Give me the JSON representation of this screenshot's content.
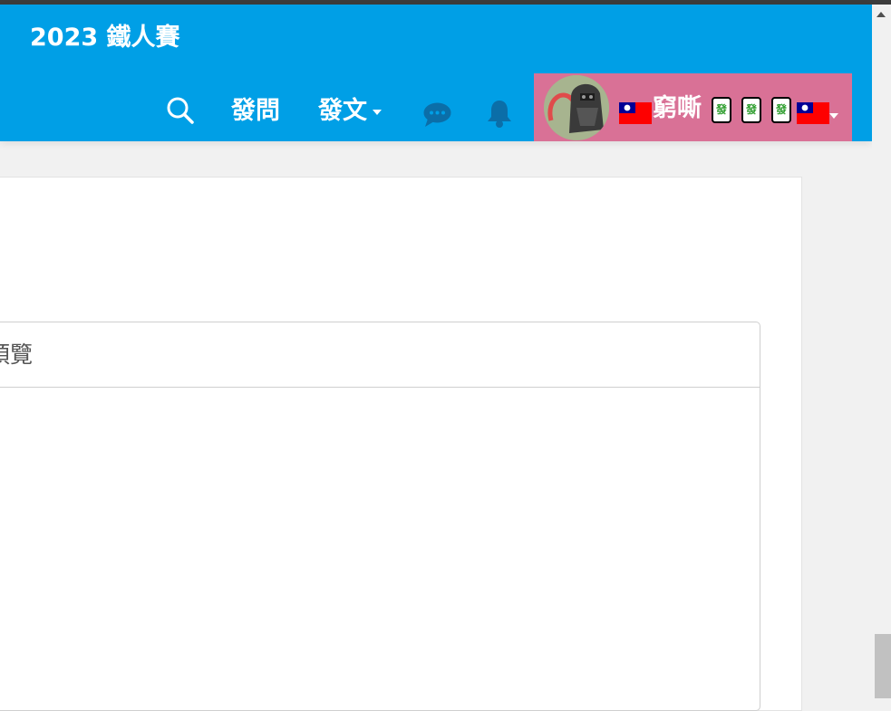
{
  "navbar": {
    "brand": "2023 鐵人賽",
    "background": "#009fe6",
    "search_icon": "search-icon",
    "ask_label": "發問",
    "post_label": "發文",
    "chat_icon": "chat-bubble-icon",
    "bell_icon": "bell-icon"
  },
  "user_menu": {
    "background": "#d97196",
    "name": "窮嘶",
    "tiles": [
      "發",
      "發",
      "發"
    ],
    "flag_icon": "taiwan-flag-icon"
  },
  "preview": {
    "title": "預覽"
  }
}
